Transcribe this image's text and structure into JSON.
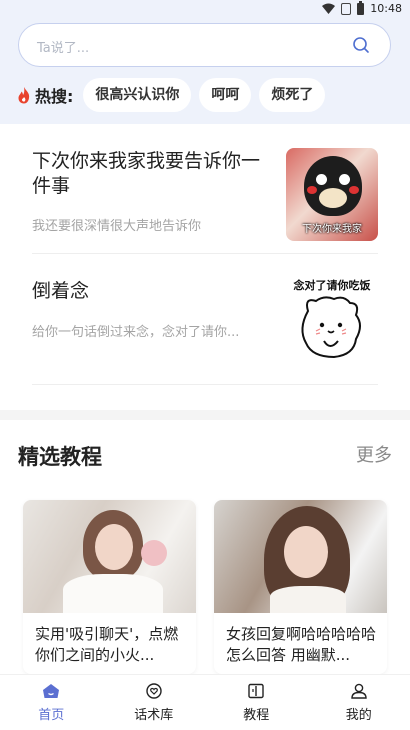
{
  "status_bar": {
    "time": "10:48"
  },
  "search": {
    "placeholder": "Ta说了..."
  },
  "hot": {
    "label": "热搜:",
    "chips": [
      "很高兴认识你",
      "呵呵",
      "烦死了"
    ]
  },
  "cards": [
    {
      "title": "下次你来我家我要告诉你一件事",
      "desc": "我还要很深情很大声地告诉你",
      "image_caption": "下次你来我家"
    },
    {
      "title": "倒着念",
      "desc": "给你一句话倒过来念，念对了请你...",
      "image_caption": "念对了请你吃饭"
    }
  ],
  "tutorials": {
    "title": "精选教程",
    "more": "更多",
    "items": [
      {
        "title": "实用'吸引聊天'，点燃你们之间的小火..."
      },
      {
        "title": "女孩回复啊哈哈哈哈哈怎么回答 用幽默..."
      }
    ]
  },
  "nav": {
    "items": [
      {
        "label": "首页",
        "icon": "home-icon",
        "active": true
      },
      {
        "label": "话术库",
        "icon": "heart-chat-icon",
        "active": false
      },
      {
        "label": "教程",
        "icon": "book-icon",
        "active": false
      },
      {
        "label": "我的",
        "icon": "user-icon",
        "active": false
      }
    ]
  },
  "colors": {
    "accent": "#5b6fd1",
    "header_bg": "#eef2fb",
    "fire": "#e8432e"
  }
}
